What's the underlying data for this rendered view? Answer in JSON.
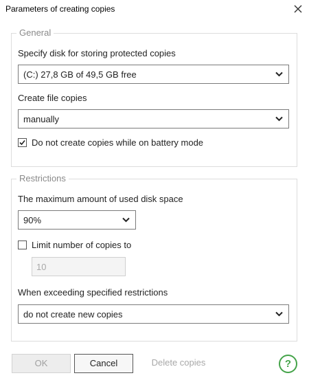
{
  "window": {
    "title": "Parameters of creating copies"
  },
  "general": {
    "legend": "General",
    "disk_label": "Specify disk for storing protected copies",
    "disk_value": "(C:)  27,8 GB of 49,5 GB free",
    "create_label": "Create file copies",
    "create_value": "manually",
    "battery_label": "Do not create copies while on battery mode",
    "battery_checked": true
  },
  "restrictions": {
    "legend": "Restrictions",
    "max_label": "The maximum amount of used disk space",
    "max_value": "90%",
    "limit_label": "Limit number of copies to",
    "limit_checked": false,
    "limit_value": "10",
    "exceed_label": "When exceeding specified restrictions",
    "exceed_value": "do not create new copies"
  },
  "footer": {
    "ok_label": "OK",
    "cancel_label": "Cancel",
    "delete_label": "Delete copies",
    "help_symbol": "?"
  },
  "icons": {
    "close": "close-icon",
    "dropdown": "chevron-down-icon",
    "check": "checkmark-icon",
    "help": "help-icon"
  },
  "colors": {
    "help_accent": "#44a349",
    "disabled_text": "#a8a8a8"
  }
}
